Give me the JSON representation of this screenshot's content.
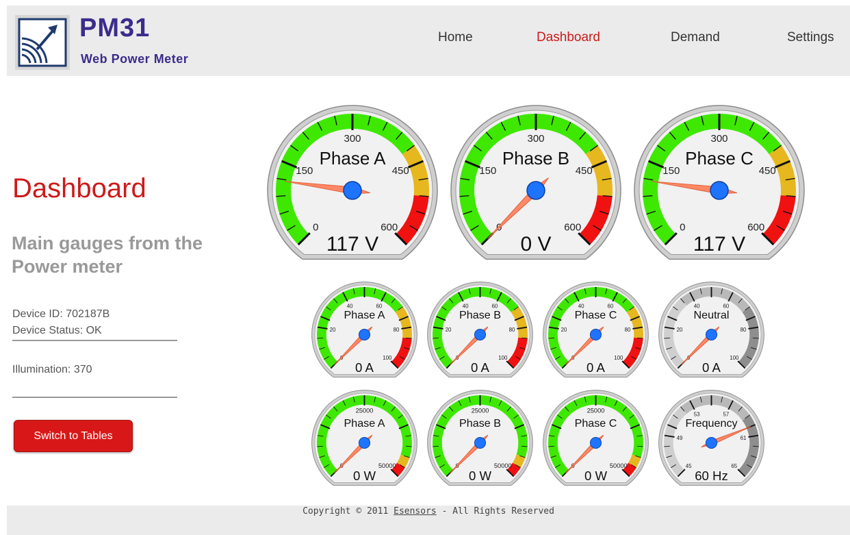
{
  "header": {
    "title": "PM31",
    "subtitle": "Web Power Meter",
    "nav": [
      {
        "label": "Home",
        "active": false
      },
      {
        "label": "Dashboard",
        "active": true
      },
      {
        "label": "Demand",
        "active": false
      },
      {
        "label": "Settings",
        "active": false
      }
    ]
  },
  "sidebar": {
    "title": "Dashboard",
    "subtitle": "Main gauges from the Power meter",
    "device_id": "Device ID: 702187B",
    "device_status": "Device Status: OK",
    "illumination": "Illumination:  370",
    "switch_button": "Switch to Tables"
  },
  "gauges": {
    "voltage": [
      {
        "label": "Phase A",
        "value_text": "117 V",
        "value": 117,
        "min": 0,
        "max": 600,
        "ticks": [
          "0",
          "150",
          "300",
          "450",
          "600"
        ],
        "theme": "color"
      },
      {
        "label": "Phase B",
        "value_text": "0 V",
        "value": 0,
        "min": 0,
        "max": 600,
        "ticks": [
          "0",
          "150",
          "300",
          "450",
          "600"
        ],
        "theme": "color"
      },
      {
        "label": "Phase C",
        "value_text": "117 V",
        "value": 117,
        "min": 0,
        "max": 600,
        "ticks": [
          "0",
          "150",
          "300",
          "450",
          "600"
        ],
        "theme": "color"
      }
    ],
    "current": [
      {
        "label": "Phase A",
        "value_text": "0 A",
        "value": 0,
        "min": 0,
        "max": 100,
        "ticks": [
          "0",
          "20",
          "40",
          "60",
          "80",
          "100"
        ],
        "theme": "color"
      },
      {
        "label": "Phase B",
        "value_text": "0 A",
        "value": 0,
        "min": 0,
        "max": 100,
        "ticks": [
          "0",
          "20",
          "40",
          "60",
          "80",
          "100"
        ],
        "theme": "color"
      },
      {
        "label": "Phase C",
        "value_text": "0 A",
        "value": 0,
        "min": 0,
        "max": 100,
        "ticks": [
          "0",
          "20",
          "40",
          "60",
          "80",
          "100"
        ],
        "theme": "color"
      },
      {
        "label": "Neutral",
        "value_text": "0 A",
        "value": 0,
        "min": 0,
        "max": 100,
        "ticks": [
          "0",
          "20",
          "40",
          "60",
          "80",
          "100"
        ],
        "theme": "gray"
      }
    ],
    "power": [
      {
        "label": "Phase A",
        "value_text": "0 W",
        "value": 0,
        "min": 0,
        "max": 50000,
        "ticks": [
          "0",
          "25000",
          "50000"
        ],
        "theme": "color"
      },
      {
        "label": "Phase B",
        "value_text": "0 W",
        "value": 0,
        "min": 0,
        "max": 50000,
        "ticks": [
          "0",
          "25000",
          "50000"
        ],
        "theme": "color"
      },
      {
        "label": "Phase C",
        "value_text": "0 W",
        "value": 0,
        "min": 0,
        "max": 50000,
        "ticks": [
          "0",
          "25000",
          "50000"
        ],
        "theme": "color"
      },
      {
        "label": "Frequency",
        "value_text": "60 Hz",
        "value": 60,
        "min": 45,
        "max": 65,
        "ticks": [
          "45",
          "49",
          "53",
          "57",
          "61",
          "65"
        ],
        "theme": "gray"
      }
    ]
  },
  "colors": {
    "accent": "#cc1a1a",
    "brand": "#3b2c8c",
    "gauge_green": "#3ee800",
    "gauge_yellow": "#e6b71e",
    "gauge_red": "#f01111",
    "needle": "#ff8866",
    "hub": "#1e74ff"
  },
  "footer": {
    "copyright_prefix": "Copyright © 2011 ",
    "copyright_link": "Esensors",
    "copyright_suffix": " - All Rights Reserved"
  }
}
